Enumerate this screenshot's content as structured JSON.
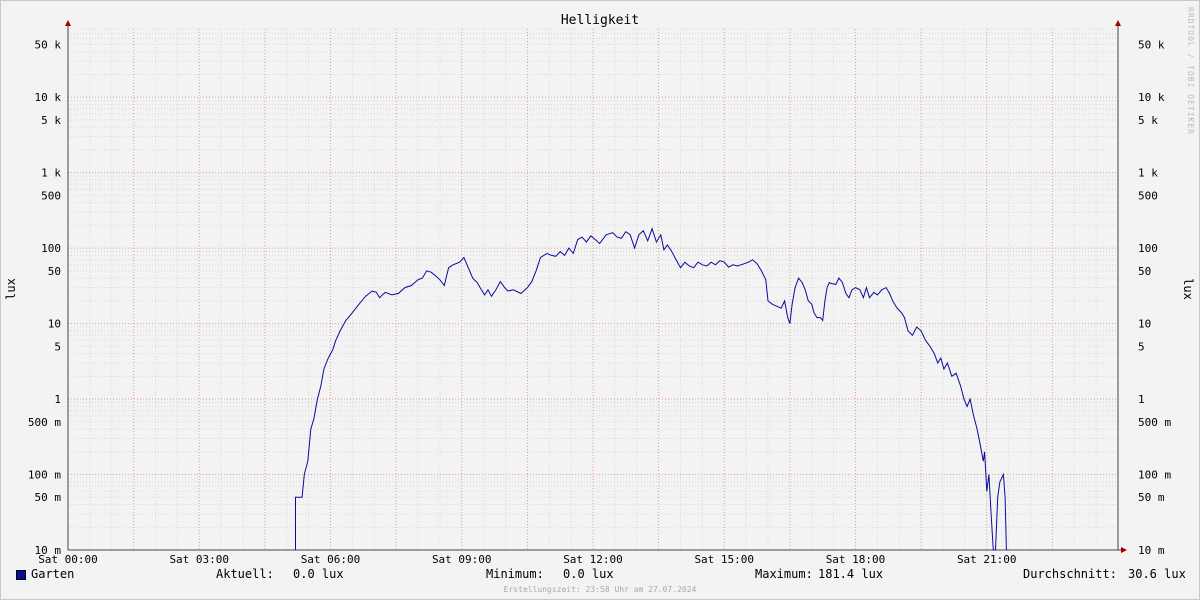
{
  "colors": {
    "series": "#0b0b9c",
    "grid_major": "#e39a9a",
    "grid_minor": "#d9d9d9",
    "axis": "#444444",
    "arrow": "#a00000"
  },
  "legend": {
    "series_name": "Garten",
    "current_label": "Aktuell:",
    "current_value": "0.0 lux",
    "min_label": "Minimum:",
    "min_value": "0.0 lux",
    "max_label": "Maximum:",
    "max_value": "181.4 lux",
    "avg_label": "Durchschnitt:",
    "avg_value": "30.6 lux"
  },
  "footer": "Erstellungszeit: 23:58 Uhr am 27.07.2024",
  "watermark": "RRDTOOL / TOBI OETIKER",
  "chart_data": {
    "type": "line",
    "title": "Helligkeit",
    "ylabel": "lux",
    "ylabel_right": "lux",
    "yscale": "log",
    "ylim": [
      10,
      80000
    ],
    "xlim": [
      0,
      24
    ],
    "grid": true,
    "y_ticks": [
      {
        "v": 50000,
        "label": "50 k"
      },
      {
        "v": 10000,
        "label": "10 k"
      },
      {
        "v": 5000,
        "label": "5 k"
      },
      {
        "v": 1000,
        "label": "1 k"
      },
      {
        "v": 500,
        "label": "500"
      },
      {
        "v": 100,
        "label": "100"
      },
      {
        "v": 50,
        "label": "50"
      },
      {
        "v": 10,
        "label": "10"
      },
      {
        "v": 5,
        "label": "5"
      },
      {
        "v": 1,
        "label": "1"
      },
      {
        "v": 0.5,
        "label": "500 m"
      },
      {
        "v": 0.1,
        "label": "100 m"
      },
      {
        "v": 0.05,
        "label": "50 m"
      },
      {
        "v": 0.01,
        "label": "10 m"
      }
    ],
    "x_ticks": [
      {
        "v": 0,
        "label": "Sat 00:00"
      },
      {
        "v": 3,
        "label": "Sat 03:00"
      },
      {
        "v": 6,
        "label": "Sat 06:00"
      },
      {
        "v": 9,
        "label": "Sat 09:00"
      },
      {
        "v": 12,
        "label": "Sat 12:00"
      },
      {
        "v": 15,
        "label": "Sat 15:00"
      },
      {
        "v": 18,
        "label": "Sat 18:00"
      },
      {
        "v": 21,
        "label": "Sat 21:00"
      }
    ],
    "series": [
      {
        "name": "Garten",
        "points": [
          [
            5.2,
            0.01
          ],
          [
            5.2,
            0.05
          ],
          [
            5.35,
            0.05
          ],
          [
            5.4,
            0.1
          ],
          [
            5.48,
            0.15
          ],
          [
            5.55,
            0.4
          ],
          [
            5.62,
            0.55
          ],
          [
            5.7,
            1.0
          ],
          [
            5.78,
            1.5
          ],
          [
            5.85,
            2.5
          ],
          [
            5.95,
            3.5
          ],
          [
            6.05,
            4.5
          ],
          [
            6.12,
            6
          ],
          [
            6.22,
            8
          ],
          [
            6.35,
            11
          ],
          [
            6.5,
            14
          ],
          [
            6.65,
            18
          ],
          [
            6.8,
            23
          ],
          [
            6.95,
            27
          ],
          [
            7.05,
            26
          ],
          [
            7.12,
            22
          ],
          [
            7.25,
            26
          ],
          [
            7.4,
            24
          ],
          [
            7.55,
            25
          ],
          [
            7.7,
            30
          ],
          [
            7.85,
            32
          ],
          [
            8.0,
            38
          ],
          [
            8.1,
            40
          ],
          [
            8.2,
            50
          ],
          [
            8.3,
            48
          ],
          [
            8.4,
            43
          ],
          [
            8.5,
            38
          ],
          [
            8.6,
            32
          ],
          [
            8.7,
            55
          ],
          [
            8.8,
            60
          ],
          [
            8.95,
            65
          ],
          [
            9.05,
            75
          ],
          [
            9.15,
            55
          ],
          [
            9.25,
            40
          ],
          [
            9.35,
            35
          ],
          [
            9.45,
            28
          ],
          [
            9.52,
            24
          ],
          [
            9.6,
            28
          ],
          [
            9.68,
            23
          ],
          [
            9.78,
            28
          ],
          [
            9.88,
            36
          ],
          [
            9.98,
            30
          ],
          [
            10.05,
            27
          ],
          [
            10.18,
            28
          ],
          [
            10.35,
            25
          ],
          [
            10.5,
            30
          ],
          [
            10.6,
            36
          ],
          [
            10.7,
            50
          ],
          [
            10.8,
            75
          ],
          [
            10.95,
            85
          ],
          [
            11.05,
            80
          ],
          [
            11.15,
            78
          ],
          [
            11.25,
            90
          ],
          [
            11.35,
            80
          ],
          [
            11.45,
            100
          ],
          [
            11.55,
            85
          ],
          [
            11.65,
            130
          ],
          [
            11.75,
            140
          ],
          [
            11.85,
            120
          ],
          [
            11.95,
            145
          ],
          [
            12.05,
            130
          ],
          [
            12.15,
            115
          ],
          [
            12.3,
            150
          ],
          [
            12.45,
            160
          ],
          [
            12.55,
            140
          ],
          [
            12.65,
            135
          ],
          [
            12.75,
            165
          ],
          [
            12.85,
            150
          ],
          [
            12.95,
            100
          ],
          [
            13.05,
            150
          ],
          [
            13.15,
            170
          ],
          [
            13.25,
            125
          ],
          [
            13.35,
            181
          ],
          [
            13.45,
            120
          ],
          [
            13.55,
            150
          ],
          [
            13.62,
            95
          ],
          [
            13.7,
            110
          ],
          [
            13.8,
            90
          ],
          [
            13.9,
            70
          ],
          [
            14.0,
            55
          ],
          [
            14.1,
            65
          ],
          [
            14.2,
            58
          ],
          [
            14.3,
            55
          ],
          [
            14.4,
            65
          ],
          [
            14.5,
            60
          ],
          [
            14.6,
            58
          ],
          [
            14.7,
            65
          ],
          [
            14.8,
            60
          ],
          [
            14.9,
            68
          ],
          [
            15.0,
            65
          ],
          [
            15.1,
            56
          ],
          [
            15.2,
            60
          ],
          [
            15.3,
            58
          ],
          [
            15.45,
            62
          ],
          [
            15.55,
            65
          ],
          [
            15.65,
            70
          ],
          [
            15.75,
            62
          ],
          [
            15.85,
            50
          ],
          [
            15.95,
            38
          ],
          [
            16.0,
            20
          ],
          [
            16.1,
            18
          ],
          [
            16.2,
            17
          ],
          [
            16.3,
            16
          ],
          [
            16.38,
            20
          ],
          [
            16.45,
            12
          ],
          [
            16.5,
            10
          ],
          [
            16.55,
            18
          ],
          [
            16.62,
            30
          ],
          [
            16.7,
            40
          ],
          [
            16.78,
            35
          ],
          [
            16.85,
            28
          ],
          [
            16.92,
            20
          ],
          [
            17.0,
            18
          ],
          [
            17.05,
            14
          ],
          [
            17.12,
            12
          ],
          [
            17.2,
            12
          ],
          [
            17.25,
            11
          ],
          [
            17.3,
            20
          ],
          [
            17.35,
            30
          ],
          [
            17.4,
            35
          ],
          [
            17.45,
            34
          ],
          [
            17.55,
            33
          ],
          [
            17.62,
            40
          ],
          [
            17.7,
            35
          ],
          [
            17.78,
            25
          ],
          [
            17.85,
            22
          ],
          [
            17.92,
            28
          ],
          [
            18.0,
            30
          ],
          [
            18.1,
            28
          ],
          [
            18.18,
            22
          ],
          [
            18.25,
            30
          ],
          [
            18.32,
            22
          ],
          [
            18.42,
            26
          ],
          [
            18.5,
            24
          ],
          [
            18.6,
            28
          ],
          [
            18.7,
            30
          ],
          [
            18.78,
            25
          ],
          [
            18.85,
            20
          ],
          [
            18.95,
            16
          ],
          [
            19.05,
            14
          ],
          [
            19.12,
            12
          ],
          [
            19.2,
            8
          ],
          [
            19.3,
            7
          ],
          [
            19.4,
            9
          ],
          [
            19.5,
            8
          ],
          [
            19.6,
            6
          ],
          [
            19.7,
            5
          ],
          [
            19.8,
            4
          ],
          [
            19.88,
            3
          ],
          [
            19.95,
            3.5
          ],
          [
            20.02,
            2.5
          ],
          [
            20.1,
            3
          ],
          [
            20.2,
            2
          ],
          [
            20.3,
            2.2
          ],
          [
            20.4,
            1.5
          ],
          [
            20.48,
            1
          ],
          [
            20.55,
            0.8
          ],
          [
            20.62,
            1.0
          ],
          [
            20.7,
            0.6
          ],
          [
            20.78,
            0.4
          ],
          [
            20.85,
            0.25
          ],
          [
            20.92,
            0.15
          ],
          [
            20.95,
            0.2
          ],
          [
            21.0,
            0.06
          ],
          [
            21.05,
            0.1
          ],
          [
            21.1,
            0.03
          ],
          [
            21.15,
            0.01
          ],
          [
            21.2,
            0.01
          ],
          [
            21.25,
            0.05
          ],
          [
            21.3,
            0.08
          ],
          [
            21.38,
            0.1
          ],
          [
            21.42,
            0.05
          ],
          [
            21.45,
            0.01
          ]
        ]
      }
    ]
  }
}
